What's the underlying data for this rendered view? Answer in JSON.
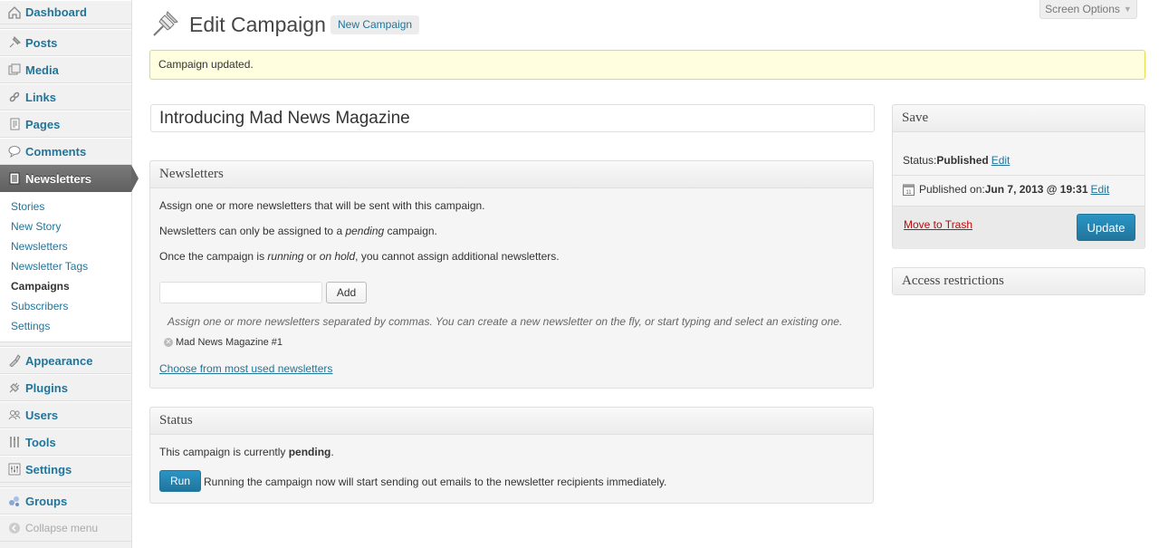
{
  "sidebar": {
    "items_top": [
      {
        "label": "Dashboard",
        "icon": "dashboard-icon"
      },
      {
        "label": "Posts",
        "icon": "pin-icon"
      },
      {
        "label": "Media",
        "icon": "media-icon"
      },
      {
        "label": "Links",
        "icon": "link-icon"
      },
      {
        "label": "Pages",
        "icon": "pages-icon"
      },
      {
        "label": "Comments",
        "icon": "comment-icon"
      },
      {
        "label": "Newsletters",
        "icon": "newsletter-icon"
      }
    ],
    "submenu": [
      "Stories",
      "New Story",
      "Newsletters",
      "Newsletter Tags",
      "Campaigns",
      "Subscribers",
      "Settings"
    ],
    "items_bottom": [
      {
        "label": "Appearance",
        "icon": "appearance-icon"
      },
      {
        "label": "Plugins",
        "icon": "plugin-icon"
      },
      {
        "label": "Users",
        "icon": "users-icon"
      },
      {
        "label": "Tools",
        "icon": "tools-icon"
      },
      {
        "label": "Settings",
        "icon": "settings-icon"
      }
    ],
    "groups": {
      "label": "Groups",
      "icon": "groups-icon"
    },
    "collapse": {
      "label": "Collapse menu",
      "icon": "collapse-icon"
    }
  },
  "header": {
    "screen_options": "Screen Options",
    "title": "Edit Campaign",
    "add_new": "New Campaign"
  },
  "notice": "Campaign updated.",
  "post_title": "Introducing Mad News Magazine",
  "newsletters_box": {
    "title": "Newsletters",
    "p1": "Assign one or more newsletters that will be sent with this campaign.",
    "p2_pre": "Newsletters can only be assigned to a ",
    "p2_em": "pending",
    "p2_post": " campaign.",
    "p3_pre": "Once the campaign is ",
    "p3_em1": "running",
    "p3_mid": " or ",
    "p3_em2": "on hold",
    "p3_post": ", you cannot assign additional newsletters.",
    "add_button": "Add",
    "hint": "Assign one or more newsletters separated by commas. You can create a new newsletter on the fly, or start typing and select an existing one.",
    "tag": "Mad News Magazine #1",
    "most_used": "Choose from most used newsletters"
  },
  "status_box": {
    "title": "Status",
    "text_pre": "This campaign is currently ",
    "text_bold": "pending",
    "text_post": ".",
    "run_button": "Run",
    "run_desc": "Running the campaign now will start sending out emails to the newsletter recipients immediately."
  },
  "save_box": {
    "title": "Save",
    "status_label": "Status: ",
    "status_value": "Published",
    "status_edit": "Edit",
    "published_label": "Published on: ",
    "published_value": "Jun 7, 2013 @ 19:31",
    "published_edit": "Edit",
    "trash": "Move to Trash",
    "update": "Update"
  },
  "access_box": {
    "title": "Access restrictions"
  },
  "colors": {
    "link": "#21759b",
    "button_primary": "#21759b",
    "trash": "#bc0b0b",
    "notice_bg": "#ffffe0",
    "notice_border": "#e6db55"
  }
}
